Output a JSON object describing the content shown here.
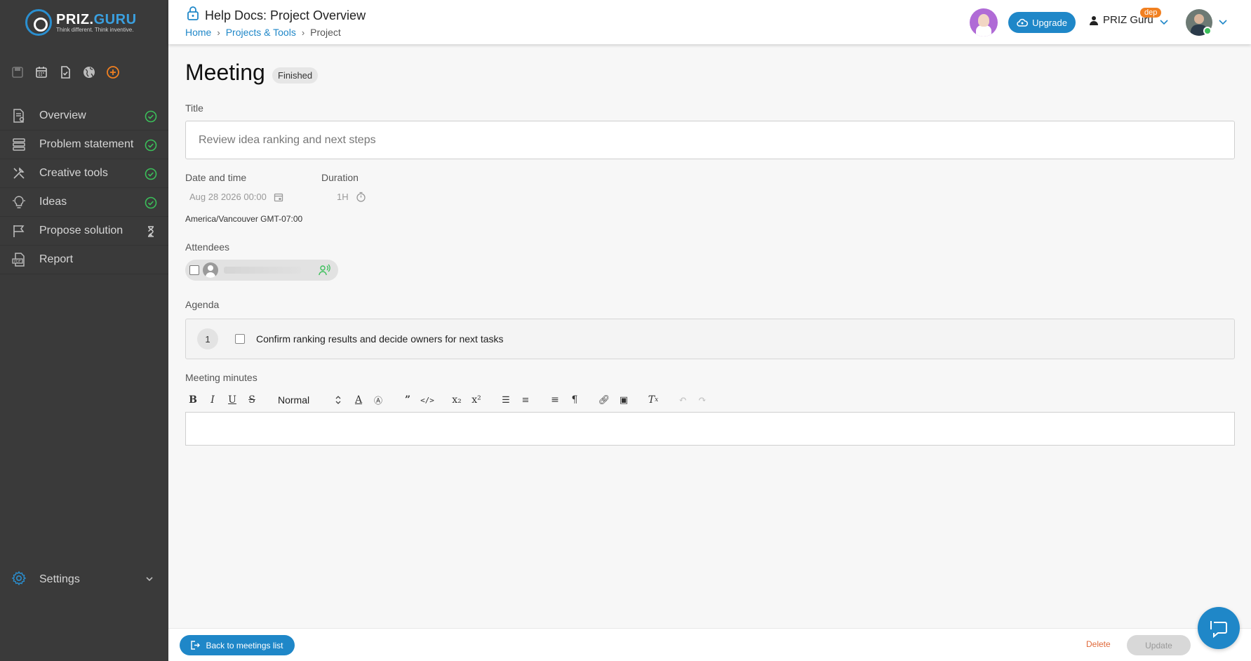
{
  "logo": {
    "brand_prefix": "PRIZ.",
    "brand_suffix": "GURU",
    "tagline": "Think different. Think inventive."
  },
  "sidebar": {
    "quick_icons": [
      "save-icon",
      "calendar-icon",
      "task-icon",
      "globe-icon",
      "add-icon"
    ],
    "items": [
      {
        "label": "Overview",
        "icon": "document-eye-icon",
        "status": "done"
      },
      {
        "label": "Problem statement",
        "icon": "stack-icon",
        "status": "done"
      },
      {
        "label": "Creative tools",
        "icon": "tools-icon",
        "status": "done"
      },
      {
        "label": "Ideas",
        "icon": "lightbulb-icon",
        "status": "done"
      },
      {
        "label": "Propose solution",
        "icon": "flag-icon",
        "status": "pending"
      },
      {
        "label": "Report",
        "icon": "pdf-icon",
        "status": ""
      }
    ],
    "settings_label": "Settings"
  },
  "header": {
    "title": "Help Docs: Project Overview",
    "breadcrumb": {
      "home": "Home",
      "projects": "Projects & Tools",
      "current": "Project"
    },
    "upgrade_label": "Upgrade",
    "user_name": "PRIZ Guru",
    "badge": "dep"
  },
  "meeting": {
    "heading": "Meeting",
    "status": "Finished",
    "title_label": "Title",
    "title_value": "Review idea ranking and next steps",
    "date_label": "Date and time",
    "date_value": "Aug 28 2026 00:00",
    "duration_label": "Duration",
    "duration_value": "1H",
    "timezone": "America/Vancouver GMT-07:00",
    "attendees_label": "Attendees",
    "attendee_name": "",
    "agenda_label": "Agenda",
    "agenda_items": [
      {
        "number": "1",
        "text": "Confirm ranking results and decide owners for next tasks"
      }
    ],
    "minutes_label": "Meeting minutes",
    "text_style": "Normal"
  },
  "footer": {
    "back_label": "Back to meetings list",
    "delete_label": "Delete",
    "update_label": "Update"
  },
  "colors": {
    "accent": "#1f87c8",
    "sidebar_bg": "#3a3a3a",
    "success": "#3bbf5a",
    "orange": "#f18021"
  }
}
